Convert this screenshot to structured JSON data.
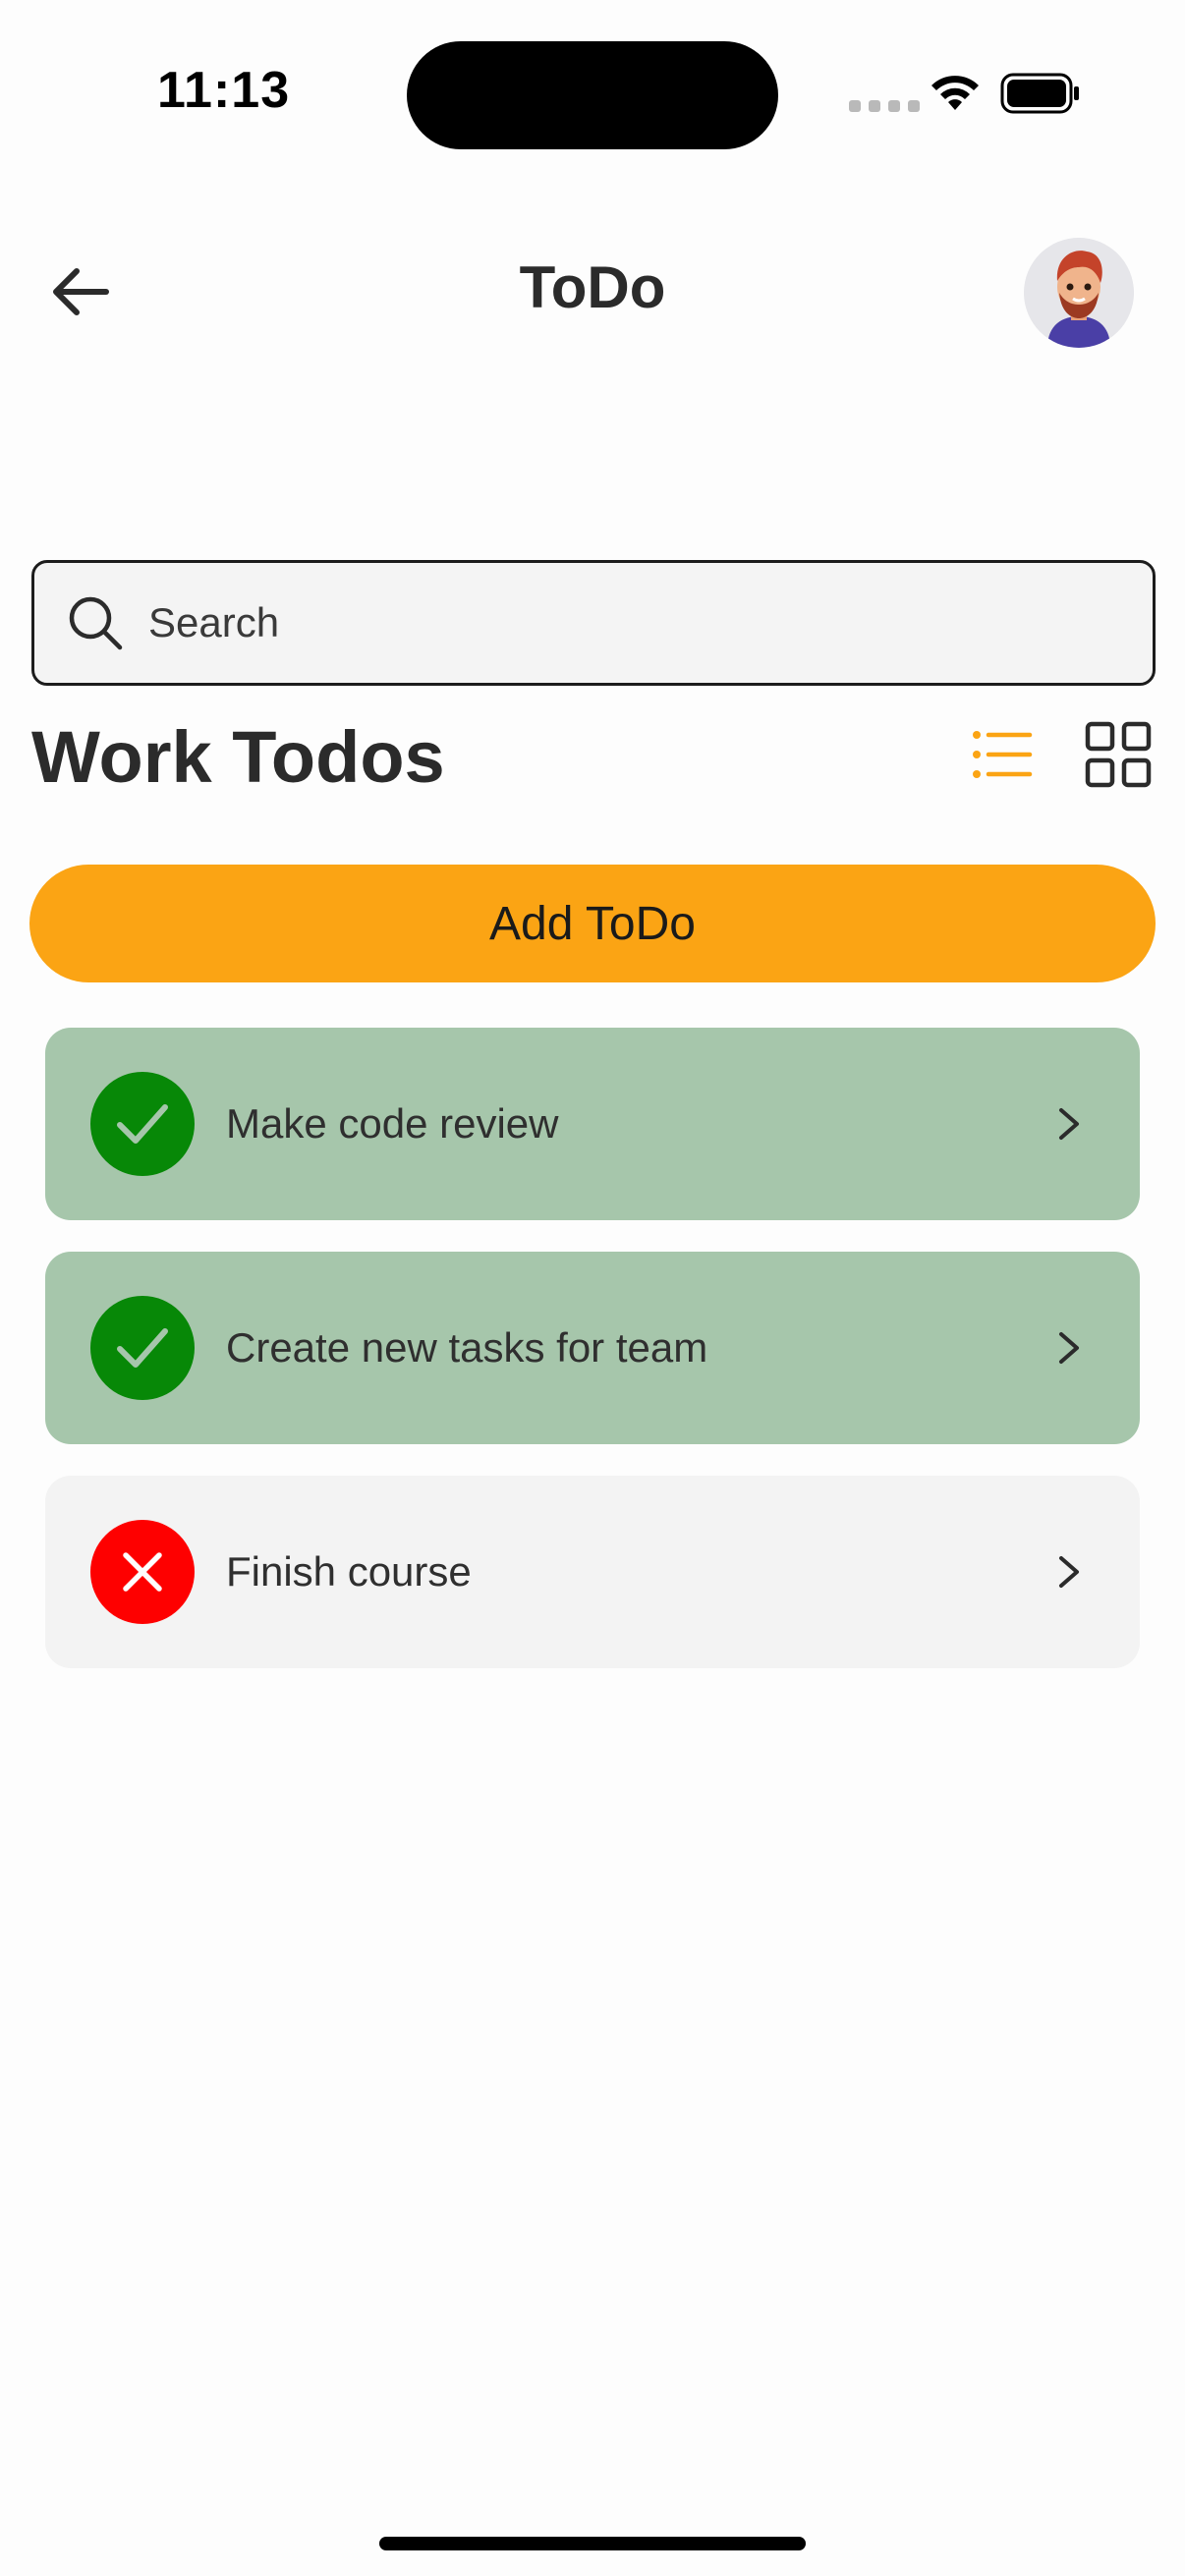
{
  "status_bar": {
    "time": "11:13",
    "icons": [
      "cellular-signal-icon",
      "wifi-icon",
      "battery-icon"
    ]
  },
  "header": {
    "title": "ToDo",
    "back_icon": "arrow-left-icon",
    "avatar_icon": "user-avatar"
  },
  "search": {
    "placeholder": "Search",
    "value": "",
    "icon": "search-icon"
  },
  "section": {
    "title": "Work Todos",
    "view_modes": [
      {
        "icon": "list-view-icon",
        "active": true
      },
      {
        "icon": "grid-view-icon",
        "active": false
      }
    ]
  },
  "add_button": {
    "label": "Add ToDo"
  },
  "todos": [
    {
      "label": "Make code review",
      "status": "done"
    },
    {
      "label": "Create new tasks for team",
      "status": "done"
    },
    {
      "label": "Finish course",
      "status": "pending"
    }
  ],
  "colors": {
    "accent": "#fba414",
    "done_bg": "#a6c6ab",
    "done_icon": "#078807",
    "pending_bg": "#f3f3f3",
    "pending_icon": "#fe0000",
    "text": "#2b2b2b"
  }
}
